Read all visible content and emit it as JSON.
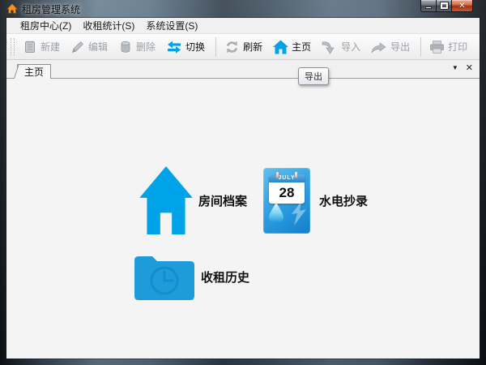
{
  "window": {
    "title": "租房管理系统"
  },
  "menu": {
    "items": [
      {
        "label": "租房中心(Z)"
      },
      {
        "label": "收租统计(S)"
      },
      {
        "label": "系统设置(S)"
      }
    ]
  },
  "toolbar": {
    "items": [
      {
        "label": "新建",
        "icon": "new-document-icon",
        "enabled": false
      },
      {
        "label": "编辑",
        "icon": "edit-pencil-icon",
        "enabled": false
      },
      {
        "label": "删除",
        "icon": "delete-trash-icon",
        "enabled": false
      },
      {
        "label": "切换",
        "icon": "switch-arrows-icon",
        "enabled": true
      },
      {
        "label": "刷新",
        "icon": "refresh-icon",
        "enabled": true
      },
      {
        "label": "主页",
        "icon": "home-icon",
        "enabled": true
      },
      {
        "label": "导入",
        "icon": "import-arrow-icon",
        "enabled": false
      },
      {
        "label": "导出",
        "icon": "export-arrow-icon",
        "enabled": false
      },
      {
        "label": "打印",
        "icon": "printer-icon",
        "enabled": false
      }
    ]
  },
  "tabs": {
    "active_label": "主页"
  },
  "tooltip": {
    "text": "导出"
  },
  "home": {
    "shortcuts": [
      {
        "label": "房间档案",
        "icon": "house-icon"
      },
      {
        "label": "水电抄录",
        "icon": "calendar-utilities-icon"
      },
      {
        "label": "收租历史",
        "icon": "folder-clock-icon"
      }
    ],
    "calendar": {
      "month": "JULY",
      "day": "28"
    }
  },
  "colors": {
    "accent_blue": "#00A2E8",
    "folder_blue": "#1D9CD9",
    "tile_blue_top": "#5EC1F0",
    "tile_blue_bottom": "#1180C9",
    "close_button_red": "#C0452A"
  }
}
